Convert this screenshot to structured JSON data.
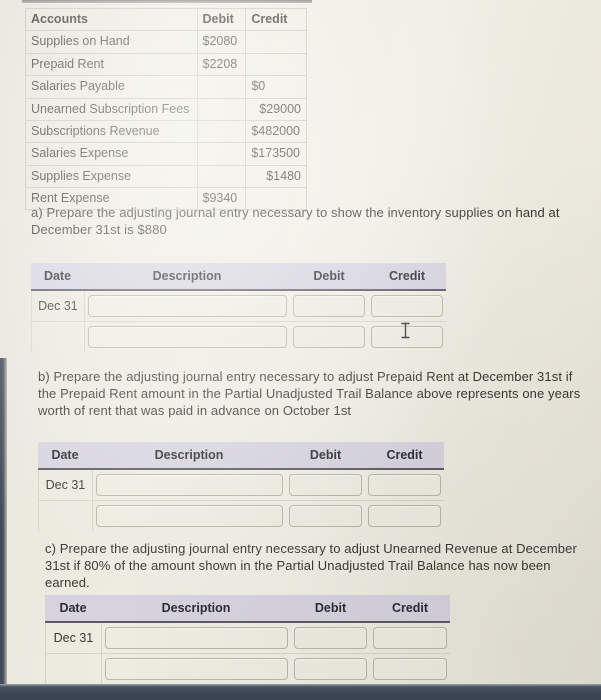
{
  "trial_balance": {
    "headers": [
      "Accounts",
      "Debit",
      "Credit"
    ],
    "rows": [
      {
        "account": "Supplies on Hand",
        "debit": "$2080",
        "credit": ""
      },
      {
        "account": "Prepaid Rent",
        "debit": "$2208",
        "credit": ""
      },
      {
        "account": "Salaries Payable",
        "debit": "",
        "credit": "$0"
      },
      {
        "account": "Unearned Subscription Fees",
        "debit": "",
        "credit": "$29000"
      },
      {
        "account": "Subscriptions Revenue",
        "debit": "",
        "credit": "$482000"
      },
      {
        "account": "Salaries Expense",
        "debit": "",
        "credit": "$173500"
      },
      {
        "account": "Supplies Expense",
        "debit": "",
        "credit": "$1480"
      },
      {
        "account": "Rent Expense",
        "debit": "$9340",
        "credit": ""
      }
    ]
  },
  "questions": {
    "a": "a) Prepare the adjusting journal entry necessary to show the inventory supplies on hand at December 31st is $880",
    "b": "b) Prepare the adjusting journal entry necessary to adjust Prepaid Rent at December 31st if the Prepaid Rent amount in the Partial Unadjusted Trail Balance above represents one years worth of rent that was paid in advance on October 1st",
    "c": "c) Prepare the adjusting journal entry necessary to adjust Unearned Revenue at December 31st if 80% of the amount shown in the Partial Unadjusted Trail Balance has now been earned."
  },
  "journal_tables": {
    "headers": {
      "date": "Date",
      "description": "Description",
      "debit": "Debit",
      "credit": "Credit"
    },
    "a": {
      "rows": [
        {
          "date": "Dec 31",
          "description": "",
          "debit": "",
          "credit": ""
        },
        {
          "date": "",
          "description": "",
          "debit": "",
          "credit": ""
        }
      ]
    },
    "b": {
      "rows": [
        {
          "date": "Dec 31",
          "description": "",
          "debit": "",
          "credit": ""
        },
        {
          "date": "",
          "description": "",
          "debit": "",
          "credit": ""
        }
      ]
    },
    "c": {
      "rows": [
        {
          "date": "Dec 31",
          "description": "",
          "debit": "",
          "credit": ""
        },
        {
          "date": "",
          "description": "",
          "debit": "",
          "credit": ""
        }
      ]
    }
  },
  "cursor": {
    "type": "text-ibeam-cursor"
  },
  "colors": {
    "paper": "#eceadf",
    "header_row": "#d6d3de",
    "header_rule": "#5c5a66",
    "field_border": "#b9b6a8",
    "desk": "#3c4553"
  }
}
